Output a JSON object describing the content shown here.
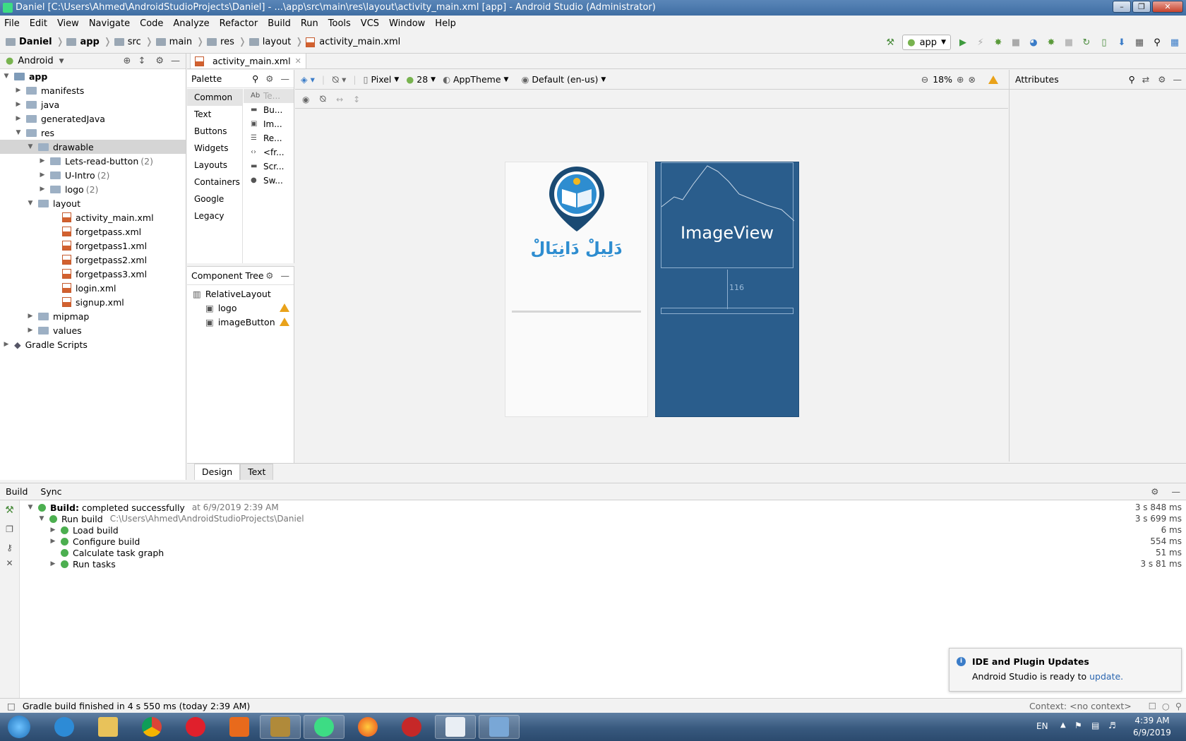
{
  "window": {
    "title": "Daniel [C:\\Users\\Ahmed\\AndroidStudioProjects\\Daniel] - ...\\app\\src\\main\\res\\layout\\activity_main.xml [app] - Android Studio (Administrator)"
  },
  "menu": [
    "File",
    "Edit",
    "View",
    "Navigate",
    "Code",
    "Analyze",
    "Refactor",
    "Build",
    "Run",
    "Tools",
    "VCS",
    "Window",
    "Help"
  ],
  "breadcrumbs": [
    "Daniel",
    "app",
    "src",
    "main",
    "res",
    "layout",
    "activity_main.xml"
  ],
  "toolbar": {
    "run_config": "app"
  },
  "project": {
    "view_mode": "Android",
    "tree": [
      {
        "label": "app",
        "indent": 0,
        "kind": "module",
        "open": true
      },
      {
        "label": "manifests",
        "indent": 1,
        "kind": "folder"
      },
      {
        "label": "java",
        "indent": 1,
        "kind": "folder"
      },
      {
        "label": "generatedJava",
        "indent": 1,
        "kind": "folder"
      },
      {
        "label": "res",
        "indent": 1,
        "kind": "folder",
        "open": true
      },
      {
        "label": "drawable",
        "indent": 2,
        "kind": "folder",
        "open": true,
        "selected": true
      },
      {
        "label": "Lets-read-button",
        "count": "(2)",
        "indent": 3,
        "kind": "folder"
      },
      {
        "label": "U-Intro",
        "count": "(2)",
        "indent": 3,
        "kind": "folder"
      },
      {
        "label": "logo",
        "count": "(2)",
        "indent": 3,
        "kind": "folder"
      },
      {
        "label": "layout",
        "indent": 2,
        "kind": "folder",
        "open": true
      },
      {
        "label": "activity_main.xml",
        "indent": 4,
        "kind": "xml"
      },
      {
        "label": "forgetpass.xml",
        "indent": 4,
        "kind": "xml"
      },
      {
        "label": "forgetpass1.xml",
        "indent": 4,
        "kind": "xml"
      },
      {
        "label": "forgetpass2.xml",
        "indent": 4,
        "kind": "xml"
      },
      {
        "label": "forgetpass3.xml",
        "indent": 4,
        "kind": "xml"
      },
      {
        "label": "login.xml",
        "indent": 4,
        "kind": "xml"
      },
      {
        "label": "signup.xml",
        "indent": 4,
        "kind": "xml"
      },
      {
        "label": "mipmap",
        "indent": 2,
        "kind": "folder"
      },
      {
        "label": "values",
        "indent": 2,
        "kind": "folder"
      },
      {
        "label": "Gradle Scripts",
        "indent": 0,
        "kind": "gradle"
      }
    ]
  },
  "editor": {
    "tab": "activity_main.xml",
    "palette": {
      "title": "Palette",
      "categories": [
        "Common",
        "Text",
        "Buttons",
        "Widgets",
        "Layouts",
        "Containers",
        "Google",
        "Legacy"
      ],
      "items": [
        "Te...",
        "Bu...",
        "Im...",
        "Re...",
        "<fr...",
        "Scr...",
        "Sw..."
      ]
    },
    "component_tree": {
      "title": "Component Tree",
      "nodes": [
        {
          "label": "RelativeLayout",
          "indent": 0
        },
        {
          "label": "logo",
          "indent": 1,
          "warn": true
        },
        {
          "label": "imageButton",
          "indent": 1,
          "warn": true
        }
      ]
    },
    "design_toolbar": {
      "device": "Pixel",
      "api": "28",
      "theme": "AppTheme",
      "locale": "Default (en-us)",
      "zoom": "18%"
    },
    "attributes_title": "Attributes",
    "preview": {
      "logo_text": "دَلِيلْ دَانِيَالْ",
      "imageview_label": "ImageView",
      "margin_label": "116"
    },
    "bottom_tabs": [
      "Design",
      "Text"
    ]
  },
  "build": {
    "tabs": [
      "Build",
      "Sync"
    ],
    "lines": [
      {
        "indent": 0,
        "bold": "Build:",
        "text": "completed successfully",
        "meta": "at 6/9/2019 2:39 AM",
        "duration": "3 s 848 ms",
        "arrow": "open"
      },
      {
        "indent": 1,
        "text": "Run build",
        "meta": "C:\\Users\\Ahmed\\AndroidStudioProjects\\Daniel",
        "duration": "3 s 699 ms",
        "arrow": "open"
      },
      {
        "indent": 2,
        "text": "Load build",
        "duration": "6 ms",
        "arrow": "closed"
      },
      {
        "indent": 2,
        "text": "Configure build",
        "duration": "554 ms",
        "arrow": "closed"
      },
      {
        "indent": 2,
        "text": "Calculate task graph",
        "duration": "51 ms",
        "arrow": ""
      },
      {
        "indent": 2,
        "text": "Run tasks",
        "duration": "3 s 81 ms",
        "arrow": "closed"
      }
    ]
  },
  "status": {
    "message": "Gradle build finished in 4 s 550 ms (today 2:39 AM)",
    "context": "Context: <no context>"
  },
  "notification": {
    "title": "IDE and Plugin Updates",
    "body": "Android Studio is ready to",
    "link": "update."
  },
  "taskbar": {
    "lang": "EN",
    "time": "4:39 AM",
    "date": "6/9/2019"
  }
}
